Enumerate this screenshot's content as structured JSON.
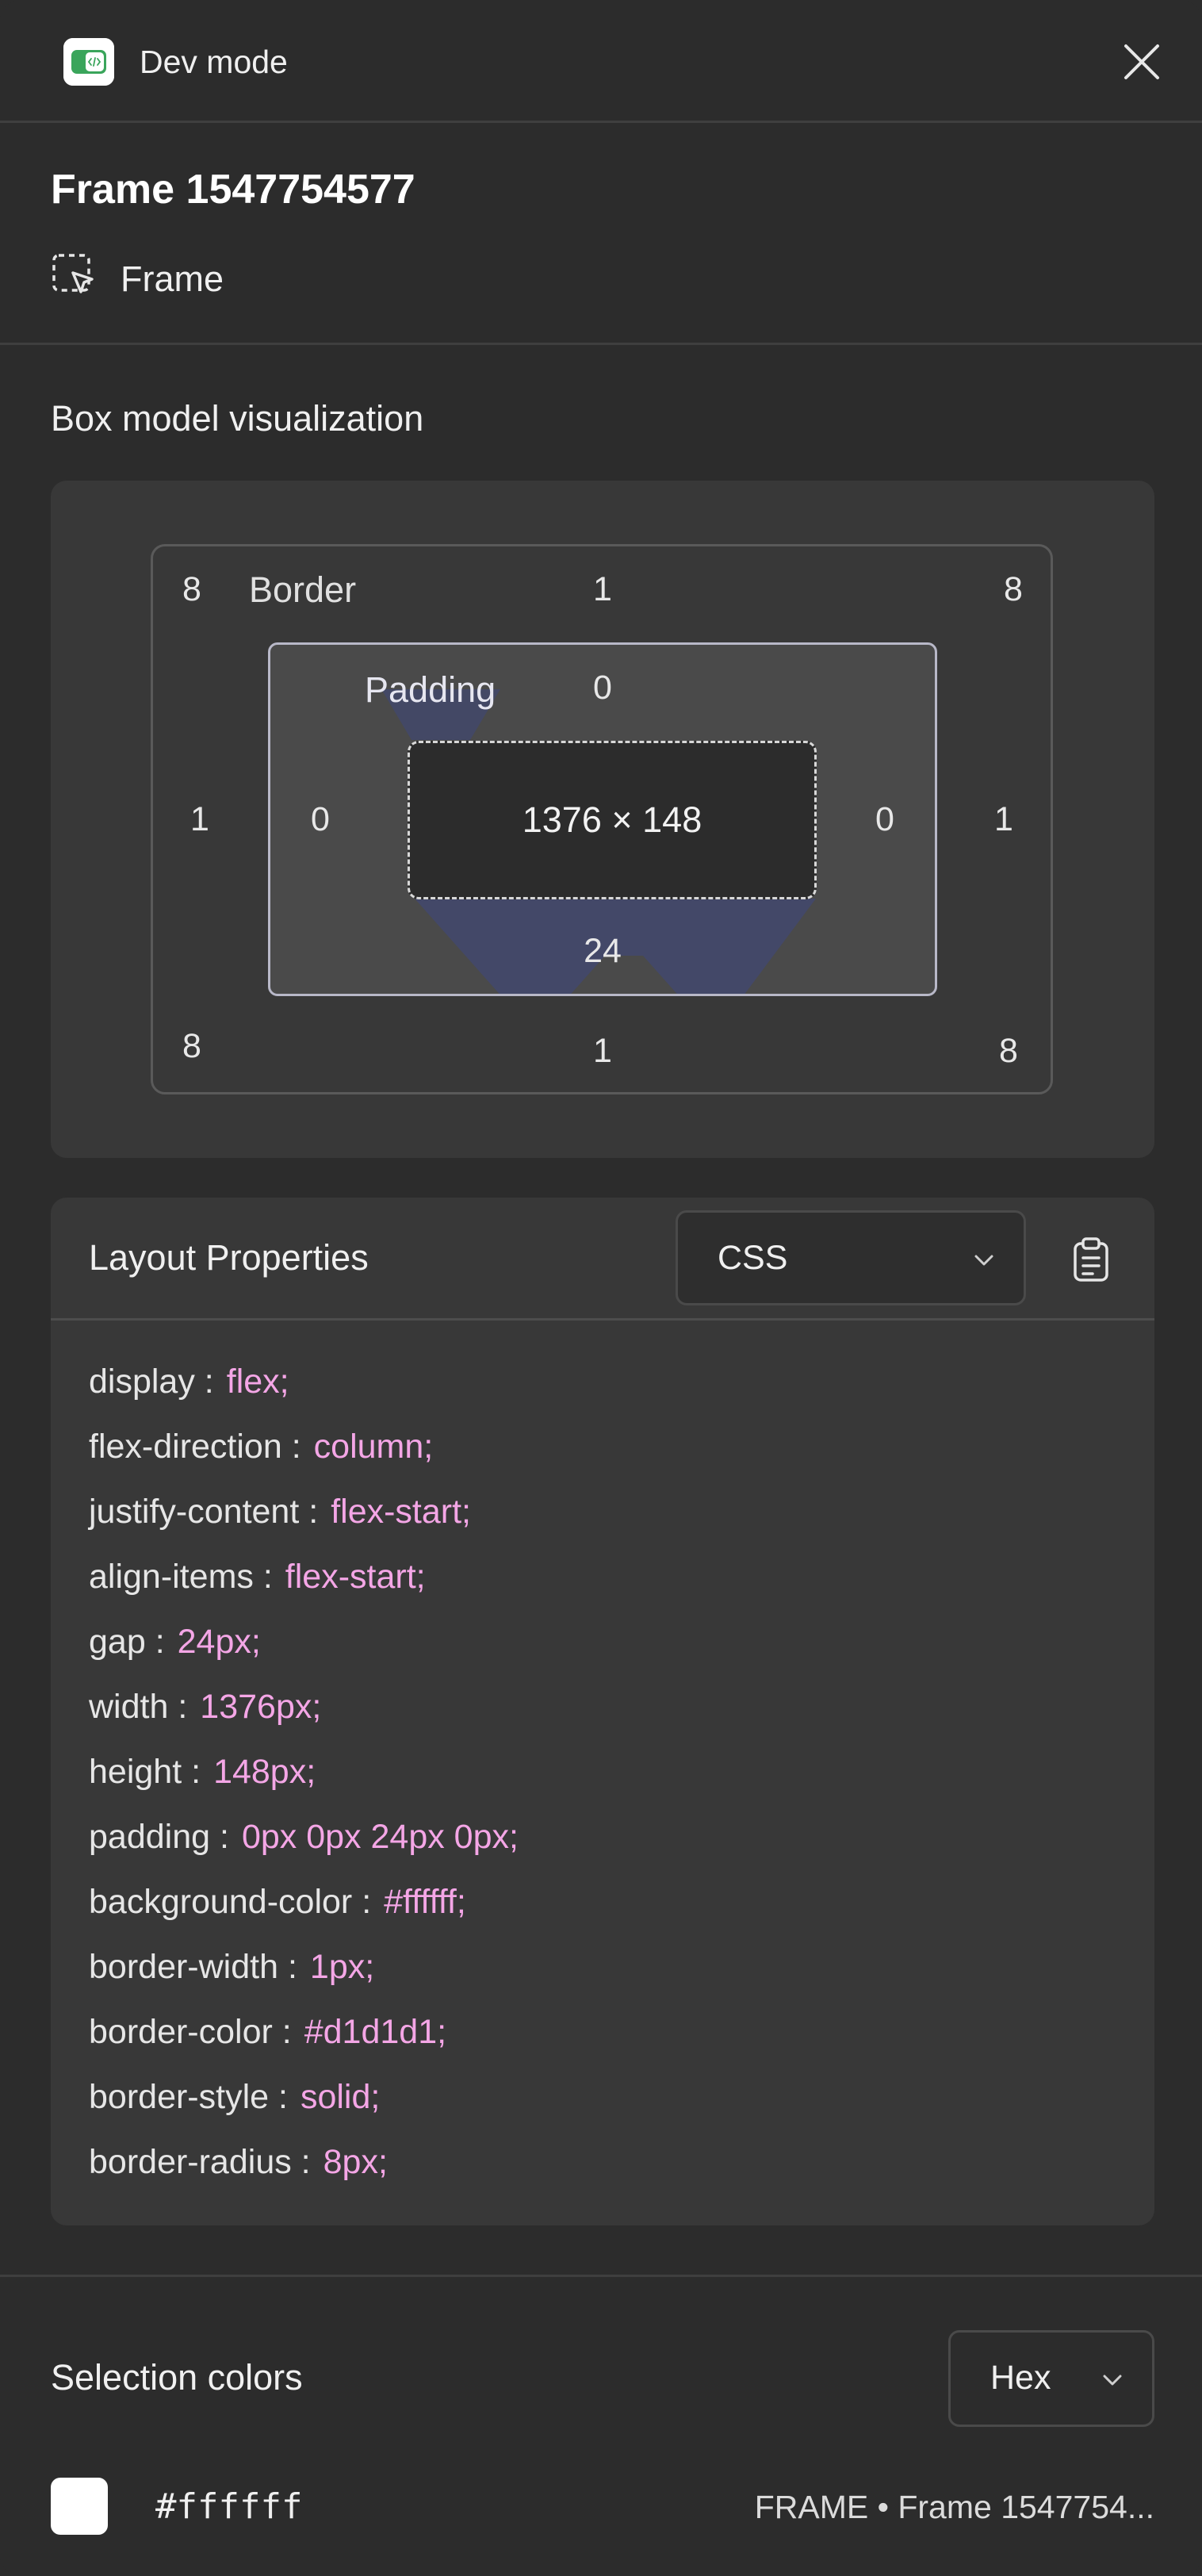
{
  "header": {
    "title": "Dev mode",
    "icon": "dev-mode-icon",
    "close_icon": "close-icon"
  },
  "selection": {
    "name": "Frame 1547754577",
    "type": "Frame",
    "type_icon": "frame-select-icon"
  },
  "box_model": {
    "title": "Box model visualization",
    "border_label": "Border",
    "padding_label": "Padding",
    "border_radius": {
      "top_left": "8",
      "top_right": "8",
      "bottom_left": "8",
      "bottom_right": "8"
    },
    "border_width": {
      "top": "1",
      "right": "1",
      "bottom": "1",
      "left": "1"
    },
    "padding": {
      "top": "0",
      "right": "0",
      "bottom": "24",
      "left": "0"
    },
    "size": "1376 × 148"
  },
  "layout": {
    "title": "Layout Properties",
    "format": "CSS",
    "format_chevron_icon": "chevron-down-icon",
    "copy_icon": "clipboard-icon",
    "properties": [
      {
        "key": "display :",
        "value": "flex;"
      },
      {
        "key": "flex-direction :",
        "value": "column;"
      },
      {
        "key": "justify-content :",
        "value": "flex-start;"
      },
      {
        "key": "align-items :",
        "value": "flex-start;"
      },
      {
        "key": "gap :",
        "value": "24px;"
      },
      {
        "key": "width :",
        "value": "1376px;"
      },
      {
        "key": "height :",
        "value": "148px;"
      },
      {
        "key": "padding :",
        "value": "0px 0px 24px 0px;"
      },
      {
        "key": "background-color :",
        "value": "#ffffff;"
      },
      {
        "key": "border-width :",
        "value": "1px;"
      },
      {
        "key": "border-color :",
        "value": "#d1d1d1;"
      },
      {
        "key": "border-style :",
        "value": "solid;"
      },
      {
        "key": "border-radius :",
        "value": "8px;"
      }
    ]
  },
  "selection_colors": {
    "title": "Selection colors",
    "format": "Hex",
    "format_chevron_icon": "chevron-down-icon",
    "items": [
      {
        "swatch": "#ffffff",
        "hex": "#ffffff",
        "source": "FRAME • Frame 1547754..."
      }
    ]
  },
  "theme": {
    "panel_bg": "#2c2c2c",
    "card_bg": "#383838",
    "value_color": "#f4a6e6",
    "padding_fill": "#4a4a4a",
    "padding_wedge": "#434868"
  }
}
